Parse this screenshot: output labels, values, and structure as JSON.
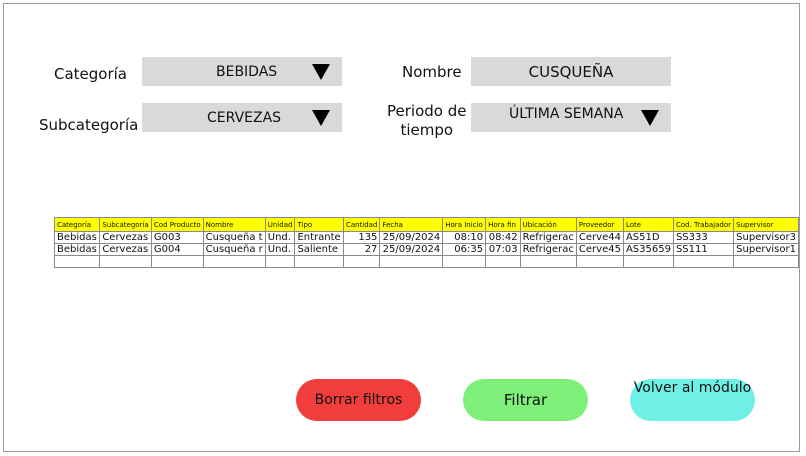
{
  "filters": {
    "categoria": {
      "label": "Categoría",
      "value": "BEBIDAS"
    },
    "subcategoria": {
      "label": "Subcategoría",
      "value": "CERVEZAS"
    },
    "nombre": {
      "label": "Nombre",
      "value": "CUSQUEÑA"
    },
    "periodo": {
      "label_line1": "Periodo de",
      "label_line2": "tiempo",
      "value": "ÚLTIMA SEMANA"
    }
  },
  "table": {
    "headers": [
      "Categoría",
      "Subcategoría",
      "Cod Producto",
      "Nombre",
      "Unidad",
      "Tipo",
      "Cantidad",
      "Fecha",
      "Hora Inicio",
      "Hora fin",
      "Ubicación",
      "Proveedor",
      "Lote",
      "Cod. Trabajador",
      "Supervisor"
    ],
    "rows": [
      [
        "Bebidas",
        "Cervezas",
        "G003",
        "Cusqueña t",
        "Und.",
        "Entrante",
        "135",
        "25/09/2024",
        "08:10",
        "08:42",
        "Refrigerac",
        "Cerve44",
        "AS51D",
        "SS333",
        "Supervisor3"
      ],
      [
        "Bebidas",
        "Cervezas",
        "G004",
        "Cusqueña r",
        "Und.",
        "Saliente",
        "27",
        "25/09/2024",
        "06:35",
        "07:03",
        "Refrigerac",
        "Cerve45",
        "AS35659",
        "SS111",
        "Supervisor1"
      ],
      [
        "",
        "",
        "",
        "",
        "",
        "",
        "",
        "",
        "",
        "",
        "",
        "",
        "",
        "",
        ""
      ]
    ]
  },
  "buttons": {
    "borrar": {
      "label": "Borrar filtros",
      "color": "#f23d3d"
    },
    "filtrar": {
      "label": "Filtrar",
      "color": "#7ef07a"
    },
    "volver": {
      "label": "Volver al módulo",
      "color": "#6ff0e6"
    }
  },
  "colors": {
    "field_bg": "#d9d9d9",
    "header_bg": "#ffff00"
  }
}
